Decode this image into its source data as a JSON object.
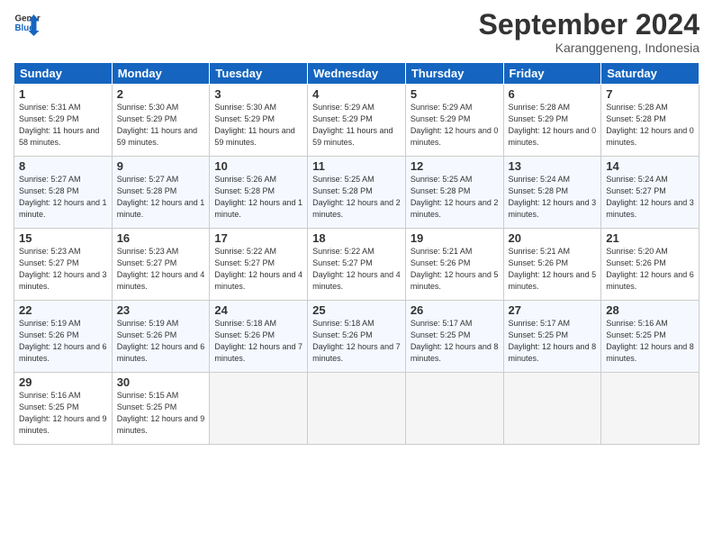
{
  "header": {
    "logo_line1": "General",
    "logo_line2": "Blue",
    "month": "September 2024",
    "location": "Karanggeneng, Indonesia"
  },
  "weekdays": [
    "Sunday",
    "Monday",
    "Tuesday",
    "Wednesday",
    "Thursday",
    "Friday",
    "Saturday"
  ],
  "weeks": [
    [
      {
        "day": "1",
        "sunrise": "Sunrise: 5:31 AM",
        "sunset": "Sunset: 5:29 PM",
        "daylight": "Daylight: 11 hours and 58 minutes."
      },
      {
        "day": "2",
        "sunrise": "Sunrise: 5:30 AM",
        "sunset": "Sunset: 5:29 PM",
        "daylight": "Daylight: 11 hours and 59 minutes."
      },
      {
        "day": "3",
        "sunrise": "Sunrise: 5:30 AM",
        "sunset": "Sunset: 5:29 PM",
        "daylight": "Daylight: 11 hours and 59 minutes."
      },
      {
        "day": "4",
        "sunrise": "Sunrise: 5:29 AM",
        "sunset": "Sunset: 5:29 PM",
        "daylight": "Daylight: 11 hours and 59 minutes."
      },
      {
        "day": "5",
        "sunrise": "Sunrise: 5:29 AM",
        "sunset": "Sunset: 5:29 PM",
        "daylight": "Daylight: 12 hours and 0 minutes."
      },
      {
        "day": "6",
        "sunrise": "Sunrise: 5:28 AM",
        "sunset": "Sunset: 5:29 PM",
        "daylight": "Daylight: 12 hours and 0 minutes."
      },
      {
        "day": "7",
        "sunrise": "Sunrise: 5:28 AM",
        "sunset": "Sunset: 5:28 PM",
        "daylight": "Daylight: 12 hours and 0 minutes."
      }
    ],
    [
      {
        "day": "8",
        "sunrise": "Sunrise: 5:27 AM",
        "sunset": "Sunset: 5:28 PM",
        "daylight": "Daylight: 12 hours and 1 minute."
      },
      {
        "day": "9",
        "sunrise": "Sunrise: 5:27 AM",
        "sunset": "Sunset: 5:28 PM",
        "daylight": "Daylight: 12 hours and 1 minute."
      },
      {
        "day": "10",
        "sunrise": "Sunrise: 5:26 AM",
        "sunset": "Sunset: 5:28 PM",
        "daylight": "Daylight: 12 hours and 1 minute."
      },
      {
        "day": "11",
        "sunrise": "Sunrise: 5:25 AM",
        "sunset": "Sunset: 5:28 PM",
        "daylight": "Daylight: 12 hours and 2 minutes."
      },
      {
        "day": "12",
        "sunrise": "Sunrise: 5:25 AM",
        "sunset": "Sunset: 5:28 PM",
        "daylight": "Daylight: 12 hours and 2 minutes."
      },
      {
        "day": "13",
        "sunrise": "Sunrise: 5:24 AM",
        "sunset": "Sunset: 5:28 PM",
        "daylight": "Daylight: 12 hours and 3 minutes."
      },
      {
        "day": "14",
        "sunrise": "Sunrise: 5:24 AM",
        "sunset": "Sunset: 5:27 PM",
        "daylight": "Daylight: 12 hours and 3 minutes."
      }
    ],
    [
      {
        "day": "15",
        "sunrise": "Sunrise: 5:23 AM",
        "sunset": "Sunset: 5:27 PM",
        "daylight": "Daylight: 12 hours and 3 minutes."
      },
      {
        "day": "16",
        "sunrise": "Sunrise: 5:23 AM",
        "sunset": "Sunset: 5:27 PM",
        "daylight": "Daylight: 12 hours and 4 minutes."
      },
      {
        "day": "17",
        "sunrise": "Sunrise: 5:22 AM",
        "sunset": "Sunset: 5:27 PM",
        "daylight": "Daylight: 12 hours and 4 minutes."
      },
      {
        "day": "18",
        "sunrise": "Sunrise: 5:22 AM",
        "sunset": "Sunset: 5:27 PM",
        "daylight": "Daylight: 12 hours and 4 minutes."
      },
      {
        "day": "19",
        "sunrise": "Sunrise: 5:21 AM",
        "sunset": "Sunset: 5:26 PM",
        "daylight": "Daylight: 12 hours and 5 minutes."
      },
      {
        "day": "20",
        "sunrise": "Sunrise: 5:21 AM",
        "sunset": "Sunset: 5:26 PM",
        "daylight": "Daylight: 12 hours and 5 minutes."
      },
      {
        "day": "21",
        "sunrise": "Sunrise: 5:20 AM",
        "sunset": "Sunset: 5:26 PM",
        "daylight": "Daylight: 12 hours and 6 minutes."
      }
    ],
    [
      {
        "day": "22",
        "sunrise": "Sunrise: 5:19 AM",
        "sunset": "Sunset: 5:26 PM",
        "daylight": "Daylight: 12 hours and 6 minutes."
      },
      {
        "day": "23",
        "sunrise": "Sunrise: 5:19 AM",
        "sunset": "Sunset: 5:26 PM",
        "daylight": "Daylight: 12 hours and 6 minutes."
      },
      {
        "day": "24",
        "sunrise": "Sunrise: 5:18 AM",
        "sunset": "Sunset: 5:26 PM",
        "daylight": "Daylight: 12 hours and 7 minutes."
      },
      {
        "day": "25",
        "sunrise": "Sunrise: 5:18 AM",
        "sunset": "Sunset: 5:26 PM",
        "daylight": "Daylight: 12 hours and 7 minutes."
      },
      {
        "day": "26",
        "sunrise": "Sunrise: 5:17 AM",
        "sunset": "Sunset: 5:25 PM",
        "daylight": "Daylight: 12 hours and 8 minutes."
      },
      {
        "day": "27",
        "sunrise": "Sunrise: 5:17 AM",
        "sunset": "Sunset: 5:25 PM",
        "daylight": "Daylight: 12 hours and 8 minutes."
      },
      {
        "day": "28",
        "sunrise": "Sunrise: 5:16 AM",
        "sunset": "Sunset: 5:25 PM",
        "daylight": "Daylight: 12 hours and 8 minutes."
      }
    ],
    [
      {
        "day": "29",
        "sunrise": "Sunrise: 5:16 AM",
        "sunset": "Sunset: 5:25 PM",
        "daylight": "Daylight: 12 hours and 9 minutes."
      },
      {
        "day": "30",
        "sunrise": "Sunrise: 5:15 AM",
        "sunset": "Sunset: 5:25 PM",
        "daylight": "Daylight: 12 hours and 9 minutes."
      },
      null,
      null,
      null,
      null,
      null
    ]
  ]
}
